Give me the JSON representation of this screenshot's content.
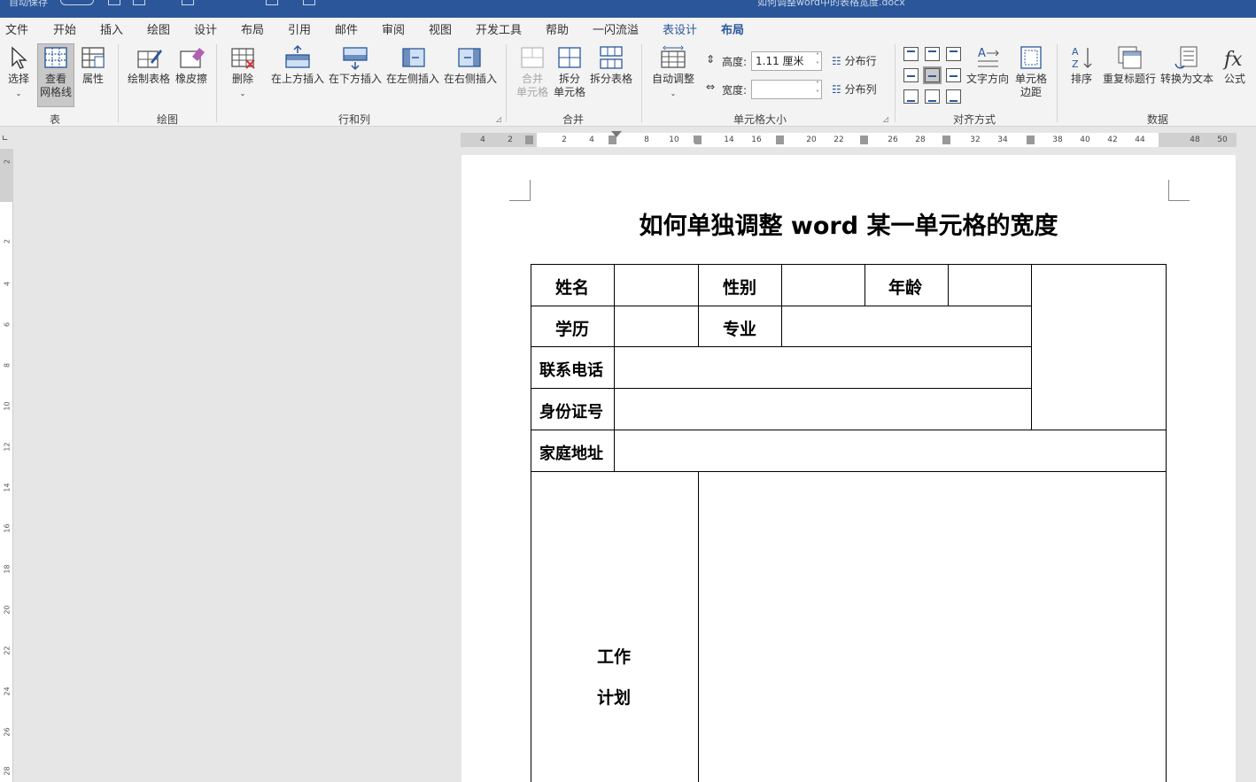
{
  "titlebar": {
    "quick_label": "自动保存",
    "doc_title": "如何调整word中的表格宽度.docx"
  },
  "menu": [
    "文件",
    "开始",
    "插入",
    "绘图",
    "设计",
    "布局",
    "引用",
    "邮件",
    "审阅",
    "视图",
    "开发工具",
    "帮助",
    "一闪流溢",
    "表设计",
    "布局"
  ],
  "ribbon": {
    "select": "选择",
    "gridlines_1": "查看",
    "gridlines_2": "网格线",
    "properties": "属性",
    "draw_table": "绘制表格",
    "eraser": "橡皮擦",
    "delete": "删除",
    "ins_above": "在上方插入",
    "ins_below": "在下方插入",
    "ins_left": "在左侧插入",
    "ins_right": "在右侧插入",
    "merge_1": "合并",
    "merge_2": "单元格",
    "split_1": "拆分",
    "split_2": "单元格",
    "split_table": "拆分表格",
    "autofit": "自动调整",
    "height_label": "高度:",
    "height_value": "1.11 厘米",
    "width_label": "宽度:",
    "width_value": "",
    "dist_rows": "分布行",
    "dist_cols": "分布列",
    "text_dir": "文字方向",
    "cell_margin_1": "单元格",
    "cell_margin_2": "边距",
    "sort": "排序",
    "repeat_header": "重复标题行",
    "to_text": "转换为文本",
    "formula": "公式",
    "groups": [
      "表",
      "绘图",
      "行和列",
      "合并",
      "单元格大小",
      "对齐方式",
      "数据"
    ]
  },
  "hruler": [
    "4",
    "2",
    "2",
    "4",
    "8",
    "10",
    "14",
    "16",
    "20",
    "22",
    "26",
    "28",
    "32",
    "34",
    "38",
    "40",
    "42",
    "44",
    "48",
    "50"
  ],
  "vruler": [
    "2",
    "2",
    "4",
    "6",
    "8",
    "10",
    "12",
    "14",
    "16",
    "18",
    "20",
    "22",
    "24",
    "26",
    "28"
  ],
  "document": {
    "title": "如何单独调整 word 某一单元格的宽度",
    "cells": {
      "name": "姓名",
      "gender": "性别",
      "age": "年龄",
      "education": "学历",
      "major": "专业",
      "phone": "联系电话",
      "id": "身份证号",
      "address": "家庭地址",
      "plan_1": "工作",
      "plan_2": "计划"
    }
  }
}
